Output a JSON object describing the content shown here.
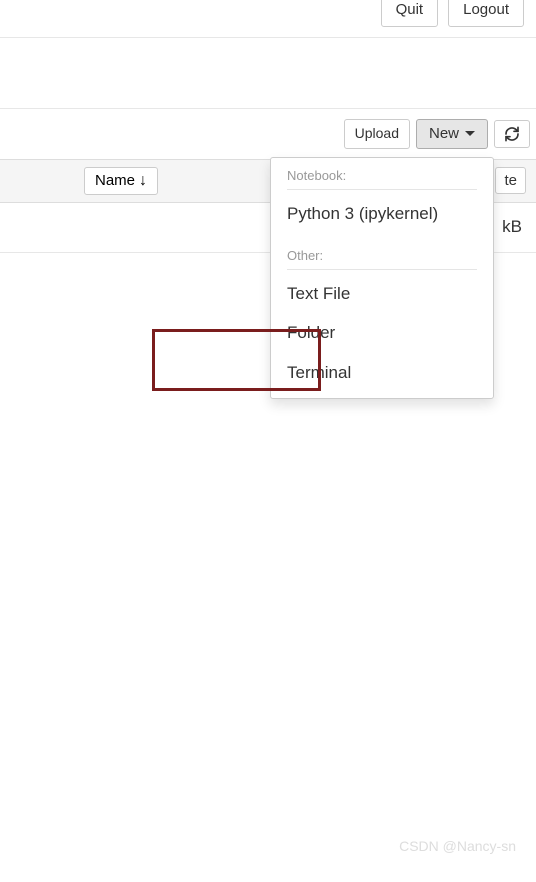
{
  "top": {
    "quit_label": "Quit",
    "logout_label": "Logout"
  },
  "toolbar": {
    "upload_label": "Upload",
    "new_label": "New"
  },
  "header": {
    "name_label": "Name",
    "partial_right": "te"
  },
  "row": {
    "size_partial": "kB"
  },
  "dropdown": {
    "notebook_header": "Notebook:",
    "notebook_items": [
      "Python 3 (ipykernel)"
    ],
    "other_header": "Other:",
    "other_items": [
      "Text File",
      "Folder",
      "Terminal"
    ]
  },
  "watermark": "CSDN @Nancy-sn"
}
